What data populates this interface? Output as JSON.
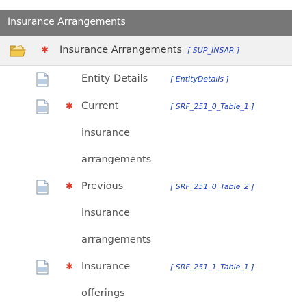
{
  "header": {
    "title": "Insurance Arrangements"
  },
  "root": {
    "icon": "folder-open-icon",
    "required": true,
    "label": "Insurance Arrangements",
    "code": "[ SUP_INSAR ]"
  },
  "items": [
    {
      "icon": "document-icon",
      "required": false,
      "label": "Entity Details",
      "code": "[ EntityDetails ]"
    },
    {
      "icon": "document-icon",
      "required": true,
      "label": "Current insurance arrangements",
      "code": "[ SRF_251_0_Table_1 ]"
    },
    {
      "icon": "document-icon",
      "required": true,
      "label": "Previous insurance arrangements",
      "code": "[ SRF_251_0_Table_2 ]"
    },
    {
      "icon": "document-icon",
      "required": true,
      "label": "Insurance offerings",
      "code": "[ SRF_251_1_Table_1 ]"
    }
  ],
  "colors": {
    "header_bg": "#777777",
    "required_star": "#e23b2a",
    "code_text": "#2244bb"
  }
}
